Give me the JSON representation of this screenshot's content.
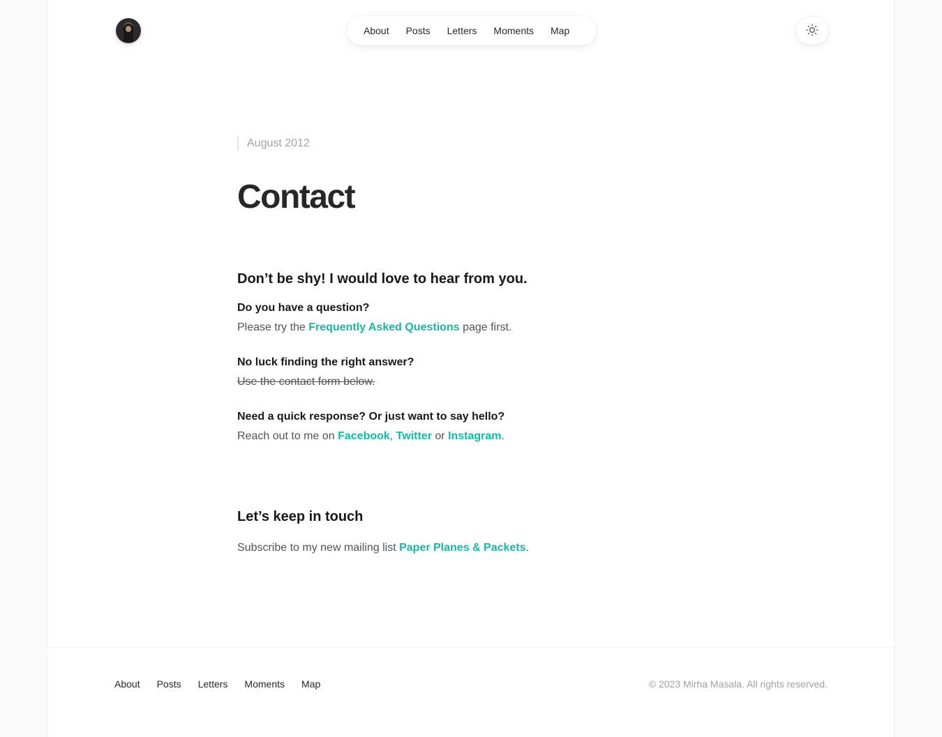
{
  "header": {
    "nav": [
      "About",
      "Posts",
      "Letters",
      "Moments",
      "Map"
    ]
  },
  "article": {
    "date": "August 2012",
    "title": "Contact",
    "heading1": "Don’t be shy! I would love to hear from you.",
    "q1": "Do you have a question?",
    "a1_pre": "Please try the ",
    "a1_link": "Frequently Asked Questions",
    "a1_post": " page first.",
    "q2": "No luck finding the right answer?",
    "a2": "Use the contact form below.",
    "q3": "Need a quick response? Or just want to say hello?",
    "a3_pre": "Reach out to me on ",
    "a3_link1": "Facebook",
    "a3_sep1": ", ",
    "a3_link2": "Twitter",
    "a3_sep2": " or ",
    "a3_link3": "Instagram",
    "a3_post": ".",
    "heading2": "Let’s keep in touch",
    "sub_pre": "Subscribe to my new mailing list ",
    "sub_link": "Paper Planes & Packets",
    "sub_post": "."
  },
  "footer": {
    "nav": [
      "About",
      "Posts",
      "Letters",
      "Moments",
      "Map"
    ],
    "copyright": "© 2023 Mirha Masala. All rights reserved."
  },
  "colors": {
    "accent": "#14b8a6",
    "text": "#27272a",
    "muted": "#a1a1aa"
  },
  "icons": {
    "theme_toggle": "sun-icon"
  }
}
